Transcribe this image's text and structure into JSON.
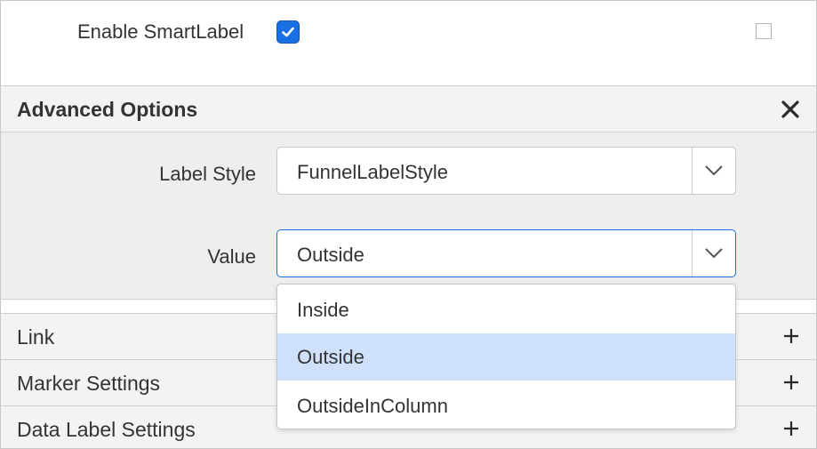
{
  "smart_label": {
    "label": "Enable SmartLabel",
    "checked": true,
    "secondary_checked": false
  },
  "advanced": {
    "title": "Advanced Options",
    "close_icon": "close-icon",
    "label_style": {
      "label": "Label Style",
      "value": "FunnelLabelStyle"
    },
    "value_field": {
      "label": "Value",
      "value": "Outside",
      "options": [
        "Inside",
        "Outside",
        "OutsideInColumn"
      ],
      "selected": "Outside"
    }
  },
  "sections": [
    {
      "title": "Link",
      "icon": "plus-icon"
    },
    {
      "title": "Marker Settings",
      "icon": "plus-icon"
    },
    {
      "title": "Data Label Settings",
      "icon": "plus-icon"
    }
  ],
  "colors": {
    "accent": "#1a6fe3",
    "selected_option_bg": "#cfe0fb",
    "panel_bg": "#eeeeee",
    "header_bg": "#f3f3f3"
  }
}
